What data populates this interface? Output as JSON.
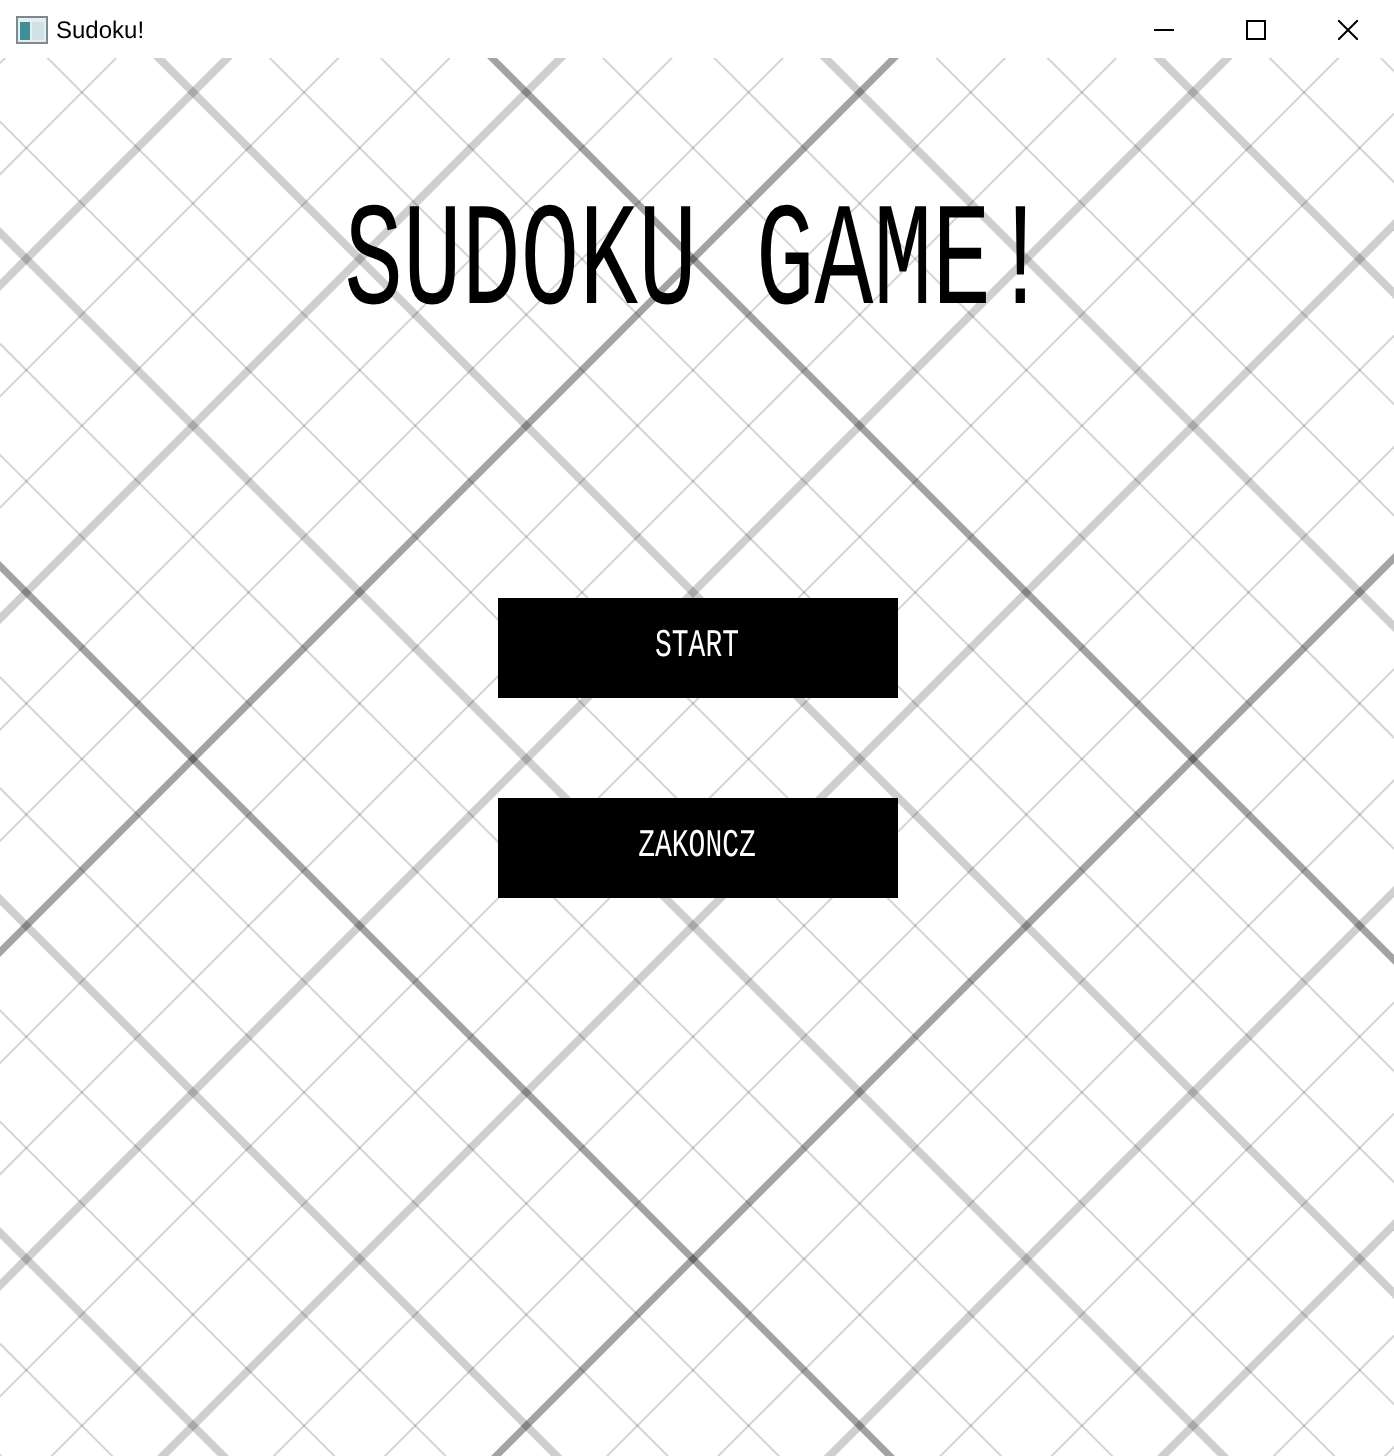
{
  "window": {
    "title": "Sudoku!"
  },
  "heading": "SUDOKU GAME!",
  "buttons": [
    {
      "label": "START"
    },
    {
      "label": "ZAKONCZ"
    }
  ]
}
